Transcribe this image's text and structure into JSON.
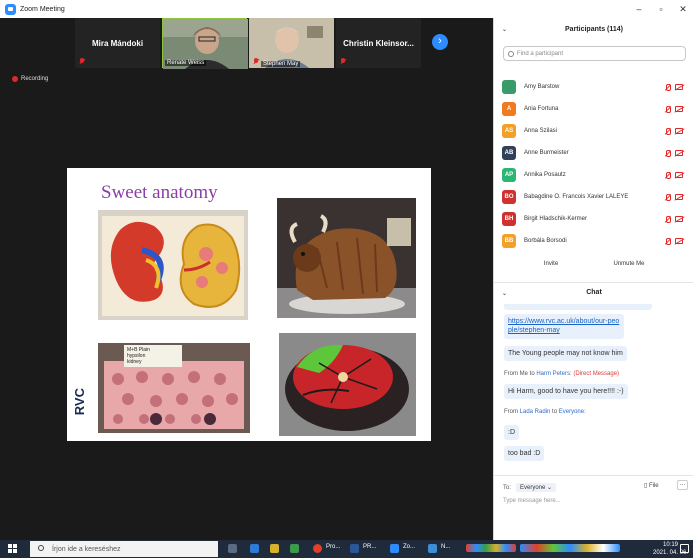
{
  "window": {
    "title": "Zoom Meeting"
  },
  "tiles": {
    "t1": "Mira Mándoki",
    "t2": "Renate Weiss",
    "t3": "Stephen May",
    "t4": "Christin  Kleinsor..."
  },
  "recording": "Recording",
  "slide": {
    "title": "Sweet anatomy",
    "plate_text": "M+B Plain\nhypsilon\nkidney",
    "logo": "RVC"
  },
  "participants": {
    "header": "Participants (114)",
    "search_placeholder": "Find a participant",
    "items": [
      {
        "initials": "",
        "name": "Amy Barstow",
        "color": "#3a9b6a"
      },
      {
        "initials": "A",
        "name": "Ania Fortuna",
        "color": "#f07a1f"
      },
      {
        "initials": "AS",
        "name": "Anna Szilasi",
        "color": "#f2a028"
      },
      {
        "initials": "AB",
        "name": "Anne Burmeister",
        "color": "#314159"
      },
      {
        "initials": "AP",
        "name": "Annika Posautz",
        "color": "#2bb673"
      },
      {
        "initials": "BO",
        "name": "Babagdine O. Francois Xavier LALEYE",
        "color": "#cf3030"
      },
      {
        "initials": "BH",
        "name": "Birgit Hladschik-Kermer",
        "color": "#cf3030"
      },
      {
        "initials": "BB",
        "name": "Borbála Borsodi",
        "color": "#f2a028"
      }
    ],
    "invite": "Invite",
    "unmute": "Unmute Me"
  },
  "chat": {
    "header": "Chat",
    "link": "https://www.rvc.ac.uk/about/our-people/stephen-may",
    "msg1": "The Young people may not know him",
    "from2_prefix": "From Me to",
    "from2_to": "Harm Peters:",
    "from2_tag": "(Direct Message)",
    "msg2": "Hi Harm, good to have you here!!!! :-)",
    "from3_prefix": "From",
    "from3_name": "Lada Radin",
    "from3_mid": "to",
    "from3_to": "Everyone:",
    "msg3": ":D",
    "msg4": "too bad :D",
    "to_label": "To:",
    "to_value": "Everyone",
    "file": "File",
    "more": "...",
    "placeholder": "Type message here..."
  },
  "taskbar": {
    "search": "Írjon ide a kereséshez",
    "app1": "Pro...",
    "app2": "PR...",
    "app3": "Zo...",
    "app4": "N...",
    "time": "10:19",
    "date": "2021. 04. 06."
  }
}
